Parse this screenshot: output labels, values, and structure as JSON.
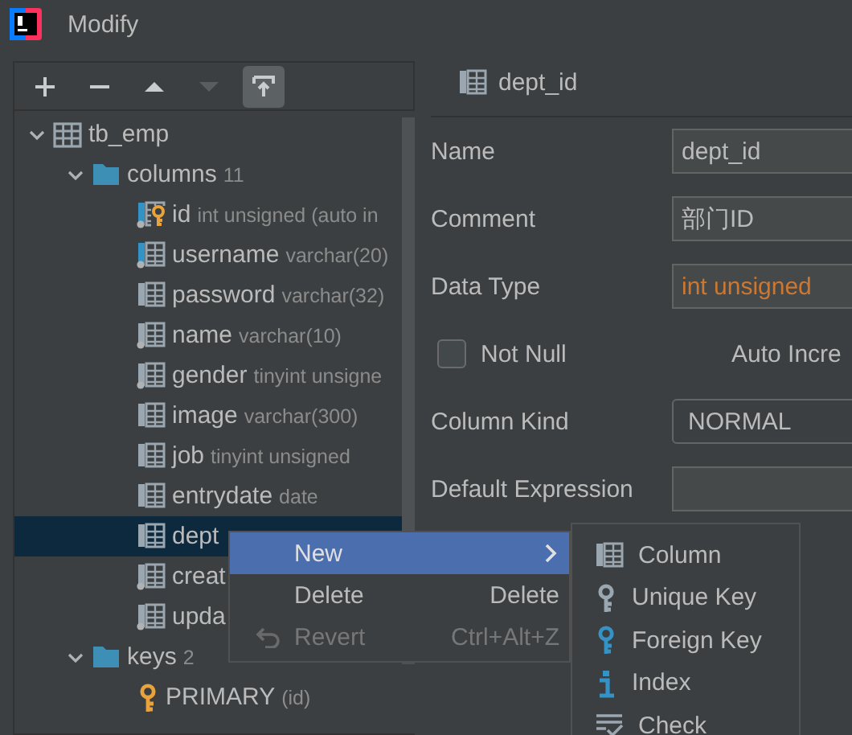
{
  "window": {
    "title": "Modify"
  },
  "toolbar": [
    {
      "kind": "add",
      "disabled": false,
      "selected": false
    },
    {
      "kind": "remove",
      "disabled": false,
      "selected": false
    },
    {
      "kind": "up",
      "disabled": false,
      "selected": false
    },
    {
      "kind": "down",
      "disabled": true,
      "selected": false
    },
    {
      "kind": "export",
      "disabled": false,
      "selected": true
    }
  ],
  "tree": {
    "label": "tb_emp",
    "expanded": true,
    "children": [
      {
        "label": "columns",
        "count": "11",
        "expanded": true,
        "children": [
          {
            "kind": "key-column",
            "name": "id",
            "type": "int unsigned (auto in",
            "indexed": true,
            "nullable": true,
            "selected": false
          },
          {
            "kind": "column",
            "name": "username",
            "type": "varchar(20)",
            "indexed": true,
            "nullable": true,
            "selected": false
          },
          {
            "kind": "column",
            "name": "password",
            "type": "varchar(32)",
            "indexed": false,
            "nullable": false,
            "selected": false
          },
          {
            "kind": "column",
            "name": "name",
            "type": "varchar(10)",
            "indexed": false,
            "nullable": true,
            "selected": false
          },
          {
            "kind": "column",
            "name": "gender",
            "type": "tinyint unsigne",
            "indexed": false,
            "nullable": true,
            "selected": false
          },
          {
            "kind": "column",
            "name": "image",
            "type": "varchar(300)",
            "indexed": false,
            "nullable": false,
            "selected": false
          },
          {
            "kind": "column",
            "name": "job",
            "type": "tinyint unsigned",
            "indexed": false,
            "nullable": false,
            "selected": false
          },
          {
            "kind": "column",
            "name": "entrydate",
            "type": "date",
            "indexed": false,
            "nullable": false,
            "selected": false
          },
          {
            "kind": "column",
            "name": "dept",
            "indexed": false,
            "nullable": false,
            "selected": true
          },
          {
            "kind": "column",
            "name": "creat",
            "indexed": false,
            "nullable": true,
            "selected": false
          },
          {
            "kind": "column",
            "name": "upda",
            "indexed": false,
            "nullable": true,
            "selected": false
          }
        ]
      },
      {
        "label": "keys",
        "count": "2",
        "expanded": true,
        "children": [
          {
            "kind": "key",
            "name": "PRIMARY",
            "type": "(id)",
            "selected": false
          }
        ]
      }
    ]
  },
  "editor": {
    "header": "dept_id",
    "fields": [
      {
        "kind": "text",
        "label": "Name",
        "value": "dept_id"
      },
      {
        "kind": "text",
        "label": "Comment",
        "value": "部门ID"
      },
      {
        "kind": "type",
        "label": "Data Type",
        "value": "int unsigned"
      },
      {
        "kind": "checks",
        "items": [
          {
            "kind": "checkbox",
            "label": "Not Null",
            "checked": false
          },
          {
            "kind": "label",
            "label": "Auto Incre"
          }
        ]
      },
      {
        "kind": "dropdown",
        "label": "Column Kind",
        "value": "NORMAL"
      },
      {
        "kind": "empty",
        "label": "Default Expression"
      }
    ]
  },
  "context_menu": [
    {
      "kind": "plain",
      "label": "New",
      "submenu": true,
      "selected": true,
      "disabled": false
    },
    {
      "kind": "plain",
      "label": "Delete",
      "shortcut": "Delete",
      "submenu": false,
      "selected": false,
      "disabled": false
    },
    {
      "kind": "undo",
      "label": "Revert",
      "shortcut": "Ctrl+Alt+Z",
      "submenu": false,
      "selected": false,
      "disabled": true
    }
  ],
  "submenu": [
    {
      "kind": "column",
      "label": "Column"
    },
    {
      "kind": "unique",
      "label": "Unique Key"
    },
    {
      "kind": "foreign",
      "label": "Foreign Key"
    },
    {
      "kind": "index",
      "label": "Index"
    },
    {
      "kind": "check",
      "label": "Check"
    }
  ]
}
